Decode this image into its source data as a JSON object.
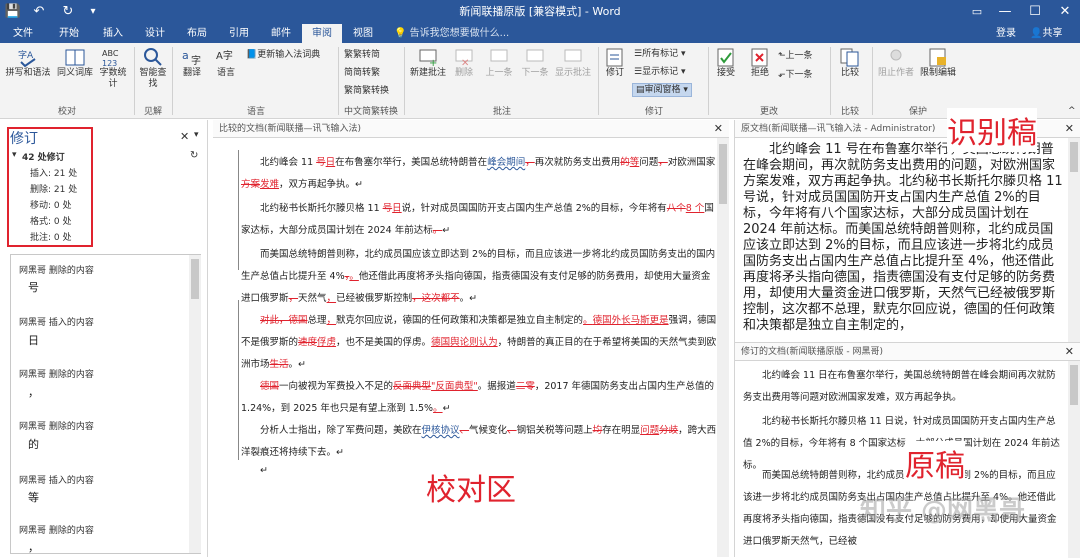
{
  "window": {
    "title": "新闻联播原版 [兼容模式] - Word",
    "quick_access": [
      "save-icon",
      "undo-icon",
      "redo-icon",
      "customize-icon"
    ],
    "controls": [
      "restore-ribbon-icon",
      "minimize-icon",
      "maximize-icon",
      "close-icon"
    ]
  },
  "menubar": {
    "tabs": [
      "文件",
      "开始",
      "插入",
      "设计",
      "布局",
      "引用",
      "邮件",
      "审阅",
      "视图"
    ],
    "active": "审阅",
    "tell_me": "告诉我您想要做什么...",
    "login": "登录",
    "share": "共享"
  },
  "ribbon": {
    "proofing": {
      "label": "校对",
      "spell": "拼写和语法",
      "thesaurus": "同义词库",
      "wordcount": "字数统计"
    },
    "insights": {
      "label": "见解",
      "smart_lookup": "智能查找"
    },
    "language": {
      "label": "语言",
      "translate": "翻译",
      "language": "语言",
      "ime_dict": "更新输入法词典"
    },
    "chinese": {
      "label": "中文简繁转换",
      "to_trad": "繁转简",
      "to_simp": "简转繁",
      "convert": "简繁转换"
    },
    "comments": {
      "label": "批注",
      "new": "新建批注",
      "delete": "删除",
      "prev": "上一条",
      "next": "下一条",
      "show": "显示批注"
    },
    "tracking": {
      "label": "修订",
      "track": "修订",
      "all_markup": "所有标记",
      "show_markup": "显示标记",
      "pane": "审阅窗格"
    },
    "changes": {
      "label": "更改",
      "accept": "接受",
      "reject": "拒绝",
      "prev": "上一条",
      "next": "下一条"
    },
    "compare": {
      "label": "比较",
      "compare": "比较"
    },
    "protect": {
      "label": "保护",
      "block": "阻止作者",
      "restrict": "限制编辑"
    }
  },
  "revision_pane": {
    "title": "修订",
    "summary": "42 处修订",
    "stats": [
      "插入: 21 处",
      "删除: 21 处",
      "移动: 0 处",
      "格式: 0 处",
      "批注: 0 处"
    ],
    "items": [
      {
        "author": "网黑哥 删除的内容",
        "value": "号"
      },
      {
        "author": "网黑哥 插入的内容",
        "value": "日"
      },
      {
        "author": "网黑哥 删除的内容",
        "value": "，"
      },
      {
        "author": "网黑哥 删除的内容",
        "value": "的"
      },
      {
        "author": "网黑哥 插入的内容",
        "value": "等"
      },
      {
        "author": "网黑哥 删除的内容",
        "value": "，"
      }
    ]
  },
  "compared": {
    "title": "比较的文档(新闻联播—讯飞输入法)"
  },
  "original": {
    "title": "原文档(新闻联播—讯飞输入法 - Administrator)",
    "text": "北约峰会 11 号在布鲁塞尔举行，美国总统特朗普在峰会期间，再次就防务支出费用的问题，对欧洲国家方案发难，双方再起争执。北约秘书长斯托尔滕贝格 11 号说，针对成员国国防开支占国内生产总值 2%的目标，今年将有八个国家达标，大部分成员国计划在 2024 年前达标。而美国总统特朗普则称，北约成员国应该立即达到 2%的目标，而且应该进一步将北约成员国防务支出占国内生产总值占比提升至 4%，他还借此再度将矛头指向德国，指责德国没有支付足够的防务费用，却使用大量资金进口俄罗斯，天然气已经被俄罗斯控制，这次都不总理，默克尔回应说，德国的任何政策和决策都是独立自主制定的，"
  },
  "revised": {
    "title": "修订的文档(新闻联播原版 - 网黑哥)",
    "p1": "北约峰会 11 日在布鲁塞尔举行，美国总统特朗普在峰会期间再次就防务支出费用等问题对欧洲国家发难，双方再起争执。",
    "p2": "北约秘书长斯托尔滕贝格 11 日说，针对成员国国防开支占国内生产总值 2%的目标，今年将有 8 个国家达标，大部分成员国计划在 2024 年前达标。",
    "p3": "而美国总统特朗普则称，北约成员国应该立即达到 2%的目标，而且应该进一步将北约成员国防务支出占国内生产总值占比提升至 4%。他还借此再度将矛头指向德国，指责德国没有支付足够的防务费用，却使用大量资金进口俄罗斯天然气，已经被"
  },
  "annotations": {
    "recognized": "识别稿",
    "proof_area": "校对区",
    "original": "原稿"
  },
  "watermark": "知乎 @网黑哥"
}
